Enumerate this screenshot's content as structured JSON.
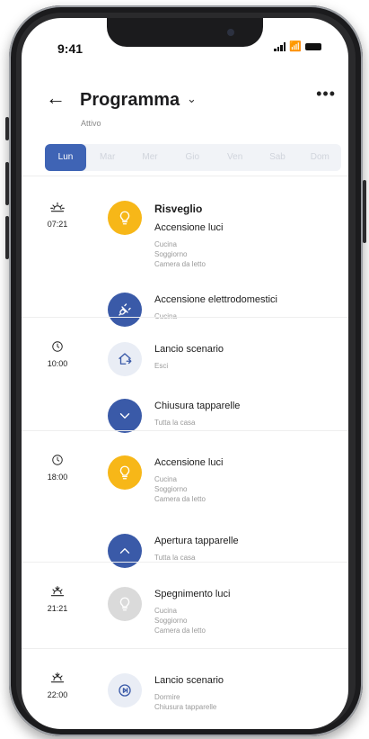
{
  "status_bar": {
    "time": "9:41"
  },
  "header": {
    "back_icon": "back-arrow-icon",
    "title": "Programma",
    "subtitle": "Attivo",
    "more_icon": "more-icon"
  },
  "days": [
    {
      "label": "Lun",
      "active": true
    },
    {
      "label": "Mar",
      "active": false
    },
    {
      "label": "Mer",
      "active": false
    },
    {
      "label": "Gio",
      "active": false
    },
    {
      "label": "Ven",
      "active": false
    },
    {
      "label": "Sab",
      "active": false
    },
    {
      "label": "Dom",
      "active": false
    }
  ],
  "schedule": [
    {
      "time": "07:21",
      "icon": "sunrise-icon",
      "entries": [
        {
          "heading": "Risveglio",
          "title": "Accensione luci",
          "details": [
            "Cucina",
            "Soggiorno",
            "Camera da letto"
          ],
          "icon": "lightbulb-icon",
          "color": "#f7b718"
        },
        {
          "title": "Accensione elettrodomestici",
          "details": [
            "Cucina"
          ],
          "icon": "plug-icon",
          "color": "#3a5aa8"
        }
      ]
    },
    {
      "time": "10:00",
      "icon": "clock-icon",
      "entries": [
        {
          "title": "Lancio scenario",
          "details": [
            "Esci"
          ],
          "icon": "house-exit-icon",
          "color": "#e9edf5"
        },
        {
          "title": "Chiusura tapparelle",
          "details": [
            "Tutta la casa"
          ],
          "icon": "chevron-down-icon",
          "color": "#3a5aa8"
        }
      ]
    },
    {
      "time": "18:00",
      "icon": "clock-icon",
      "entries": [
        {
          "title": "Accensione luci",
          "details": [
            "Cucina",
            "Soggiorno",
            "Camera da letto"
          ],
          "icon": "lightbulb-icon",
          "color": "#f7b718"
        },
        {
          "title": "Apertura tapparelle",
          "details": [
            "Tutta la casa"
          ],
          "icon": "chevron-up-icon",
          "color": "#3a5aa8"
        }
      ]
    },
    {
      "time": "21:21",
      "icon": "sunset-icon",
      "entries": [
        {
          "title": "Spegnimento luci",
          "details": [
            "Cucina",
            "Soggiorno",
            "Camera da letto"
          ],
          "icon": "lightbulb-icon",
          "color": "#dadada"
        }
      ]
    },
    {
      "time": "22:00",
      "icon": "sunset-icon",
      "entries": [
        {
          "title": "Lancio scenario",
          "details": [
            "Dormire",
            "Chiusura tapparelle"
          ],
          "icon": "play-scenario-icon",
          "color": "#e9edf5"
        }
      ]
    }
  ]
}
